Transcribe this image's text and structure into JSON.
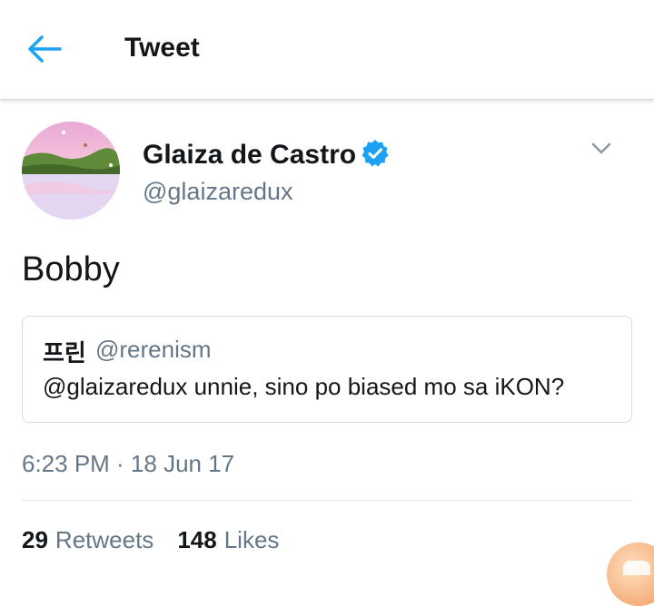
{
  "header": {
    "title": "Tweet",
    "back_icon": "back-arrow-icon"
  },
  "tweet": {
    "author_name": "Glaiza de Castro",
    "handle": "@glaizaredux",
    "verified_icon": "verified-badge-icon",
    "text": "Bobby",
    "timestamp": "6:23 PM · 18 Jun 17"
  },
  "quoted_tweet": {
    "author_name": "프린",
    "handle": "@rerenism",
    "text": "@glaizaredux unnie, sino po biased mo sa iKON?"
  },
  "stats": {
    "retweets_count": "29",
    "retweets_label": "Retweets",
    "likes_count": "148",
    "likes_label": "Likes"
  },
  "colors": {
    "accent": "#1da1f2",
    "text_primary": "#14171a",
    "text_secondary": "#657786",
    "border": "#d6dbdf"
  }
}
